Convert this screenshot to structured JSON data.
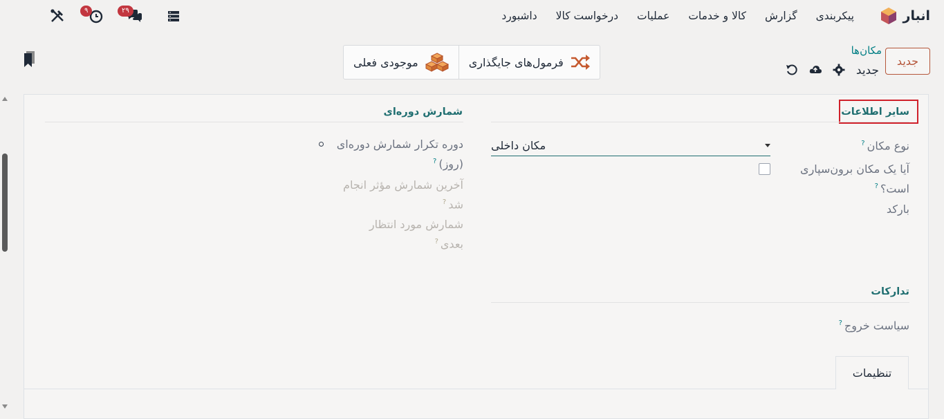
{
  "navbar": {
    "brand": "انبار",
    "menu": [
      "داشبورد",
      "درخواست کالا",
      "عملیات",
      "کالا و خدمات",
      "گزارش",
      "پیکربندی"
    ],
    "messages_badge": "۲۹",
    "activity_badge": "۹"
  },
  "control": {
    "new_label": "جدید",
    "breadcrumb": "مکان‌ها",
    "record_name": "جدید",
    "smart_buttons": [
      "فرمول‌های جایگذاری",
      "موجودی فعلی"
    ]
  },
  "form": {
    "section_other": "سایر اطلاعات",
    "section_cycle": "شمارش دوره‌ای",
    "section_logistics": "تدارکات",
    "location_type_label": "نوع مکان",
    "location_type_value": "مکان داخلی",
    "subcontract_label_1": "آیا یک مکان برون‌سپاری",
    "subcontract_label_2": "است؟",
    "barcode_label": "بارکد",
    "cycle_freq_label_1": "دوره تکرار شمارش دوره‌ای",
    "cycle_freq_label_2": "(روز)",
    "last_count_label_1": "آخرین شمارش مؤثر انجام",
    "last_count_label_2": "شد",
    "next_count_label_1": "شمارش مورد انتظار",
    "next_count_label_2": "بعدی",
    "removal_label": "سیاست خروج",
    "help_mark": "?"
  },
  "tabs": {
    "settings": "تنظیمات"
  },
  "colors": {
    "accent": "#b5563a",
    "teal": "#017e84",
    "highlight": "#d0202a"
  }
}
